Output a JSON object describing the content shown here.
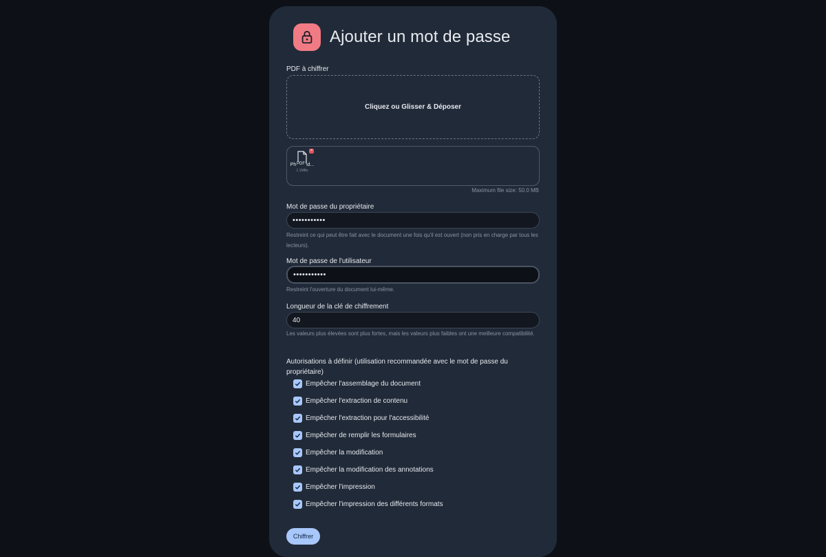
{
  "header": {
    "title": "Ajouter un mot de passe",
    "icon": "lock-icon"
  },
  "colors": {
    "accent": "#a8c7fa",
    "lock_bg": "#f17b84",
    "background": "#0d1117",
    "card": "#212a38"
  },
  "upload": {
    "label": "PDF à chiffrer",
    "dropzone_text": "Cliquez ou Glisser & Déposer",
    "file": {
      "type": "PDF",
      "name": "PhonAnd...",
      "size": "1.1MBs"
    },
    "max_size": "Maximum file size: 50.0 MB"
  },
  "owner_password": {
    "label": "Mot de passe du propriétaire",
    "value": "•••••••••••",
    "help": "Restreint ce qui peut être fait avec le document une fois qu'il est ouvert (non pris en charge par tous les lecteurs)."
  },
  "user_password": {
    "label": "Mot de passe de l'utilisateur",
    "value": "•••••••••••",
    "help": "Restreint l'ouverture du document lui-même."
  },
  "key_length": {
    "label": "Longueur de la clé de chiffrement",
    "value": "40",
    "help": "Les valeurs plus élevées sont plus fortes, mais les valeurs plus faibles ont une meilleure compatibilité."
  },
  "permissions": {
    "title": "Autorisations à définir (utilisation recommandée avec le mot de passe du propriétaire)",
    "items": [
      {
        "label": "Empêcher l'assemblage du document",
        "checked": true
      },
      {
        "label": "Empêcher l'extraction de contenu",
        "checked": true
      },
      {
        "label": "Empêcher l'extraction pour l'accessibilité",
        "checked": true
      },
      {
        "label": "Empêcher de remplir les formulaires",
        "checked": true
      },
      {
        "label": "Empêcher la modification",
        "checked": true
      },
      {
        "label": "Empêcher la modification des annotations",
        "checked": true
      },
      {
        "label": "Empêcher l'impression",
        "checked": true
      },
      {
        "label": "Empêcher l'impression des différents formats",
        "checked": true
      }
    ]
  },
  "submit_label": "Chiffrer"
}
